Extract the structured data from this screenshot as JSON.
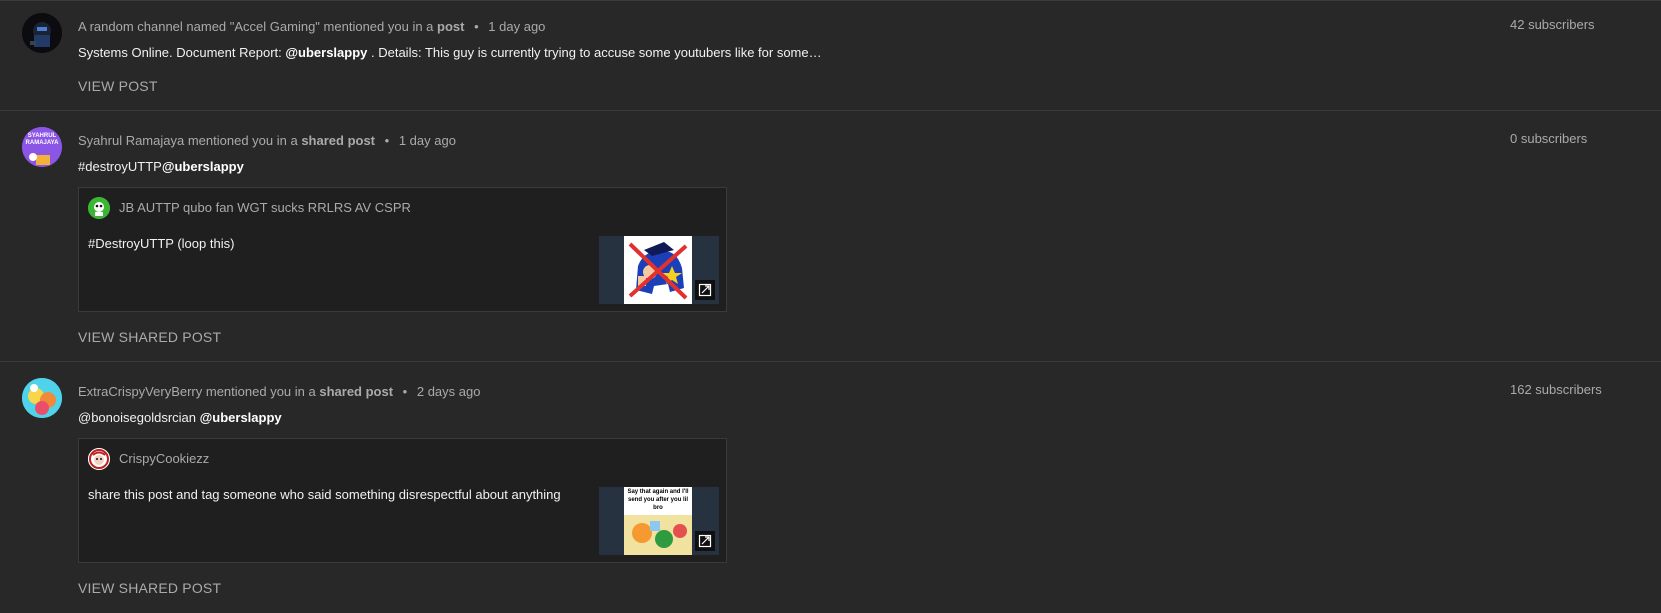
{
  "notifications": [
    {
      "author": "A random channel named \"Accel Gaming\"",
      "action": "mentioned you in a",
      "target": "post",
      "time": "1 day ago",
      "subscribers": "42 subscribers",
      "text_before": "Systems Online. Document Report: ",
      "mention": "@uberslappy",
      "text_after": " . Details: This guy is currently trying to accuse some youtubers like for some…",
      "link_label": "VIEW POST"
    },
    {
      "author": "Syahrul Ramajaya",
      "action": "mentioned you in a",
      "target": "shared post",
      "time": "1 day ago",
      "subscribers": "0 subscribers",
      "text_before": "#destroyUTTP",
      "mention": "@uberslappy",
      "avatar_text": "SYAHRUL RAMAJAYA",
      "shared": {
        "author": "JB AUTTP qubo fan WGT sucks RRLRS AV CSPR",
        "text": "#DestroyUTTP (loop this)"
      },
      "link_label": "VIEW SHARED POST"
    },
    {
      "author": "ExtraCrispyVeryBerry",
      "action": "mentioned you in a",
      "target": "shared post",
      "time": "2 days ago",
      "subscribers": "162 subscribers",
      "text_before": "@bonoisegoldsrcian ",
      "mention": "@uberslappy",
      "shared": {
        "author": "CrispyCookiezz",
        "text": "share this post and tag someone who said something disrespectful about anything",
        "thumb_text": "Say that again and I'll send you after you lil bro"
      },
      "link_label": "VIEW SHARED POST"
    }
  ],
  "separator": "•",
  "icons": {
    "thumbnail_badge": "open-external-icon"
  }
}
